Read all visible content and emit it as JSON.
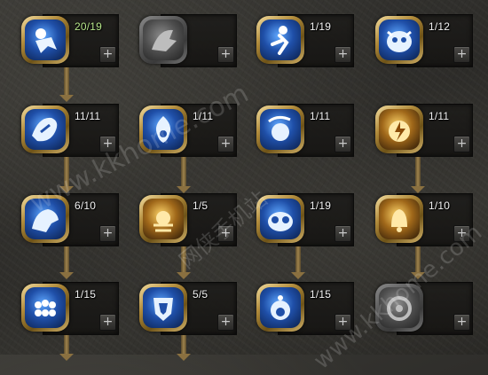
{
  "skill_tree": {
    "plus_label": "+",
    "rows": [
      [
        {
          "count": "20/19",
          "icon": "warrior-leap-icon",
          "state": "active",
          "highlight": true
        },
        {
          "count": "",
          "icon": "beast-claw-icon",
          "state": "locked"
        },
        {
          "count": "1/19",
          "icon": "running-figure-icon",
          "state": "active"
        },
        {
          "count": "1/12",
          "icon": "creature-face-icon",
          "state": "active"
        }
      ],
      [
        {
          "count": "11/11",
          "icon": "dragon-burst-icon",
          "state": "active"
        },
        {
          "count": "1/11",
          "icon": "flame-shield-icon",
          "state": "active"
        },
        {
          "count": "1/11",
          "icon": "orb-splash-icon",
          "state": "active"
        },
        {
          "count": "1/11",
          "icon": "lightning-orb-icon",
          "state": "golden"
        }
      ],
      [
        {
          "count": "6/10",
          "icon": "wolf-pounce-icon",
          "state": "active"
        },
        {
          "count": "1/5",
          "icon": "spider-rune-icon",
          "state": "golden"
        },
        {
          "count": "1/19",
          "icon": "goggle-face-icon",
          "state": "active"
        },
        {
          "count": "1/10",
          "icon": "bell-rune-icon",
          "state": "golden"
        }
      ],
      [
        {
          "count": "1/15",
          "icon": "paw-print-icon",
          "state": "active"
        },
        {
          "count": "5/5",
          "icon": "shield-crest-icon",
          "state": "active"
        },
        {
          "count": "1/15",
          "icon": "bubble-ring-icon",
          "state": "active"
        },
        {
          "count": "",
          "icon": "sun-wheel-icon",
          "state": "locked"
        }
      ]
    ]
  },
  "watermark": {
    "line1": "www.kkhome.com",
    "line2": "网侠手机站"
  }
}
